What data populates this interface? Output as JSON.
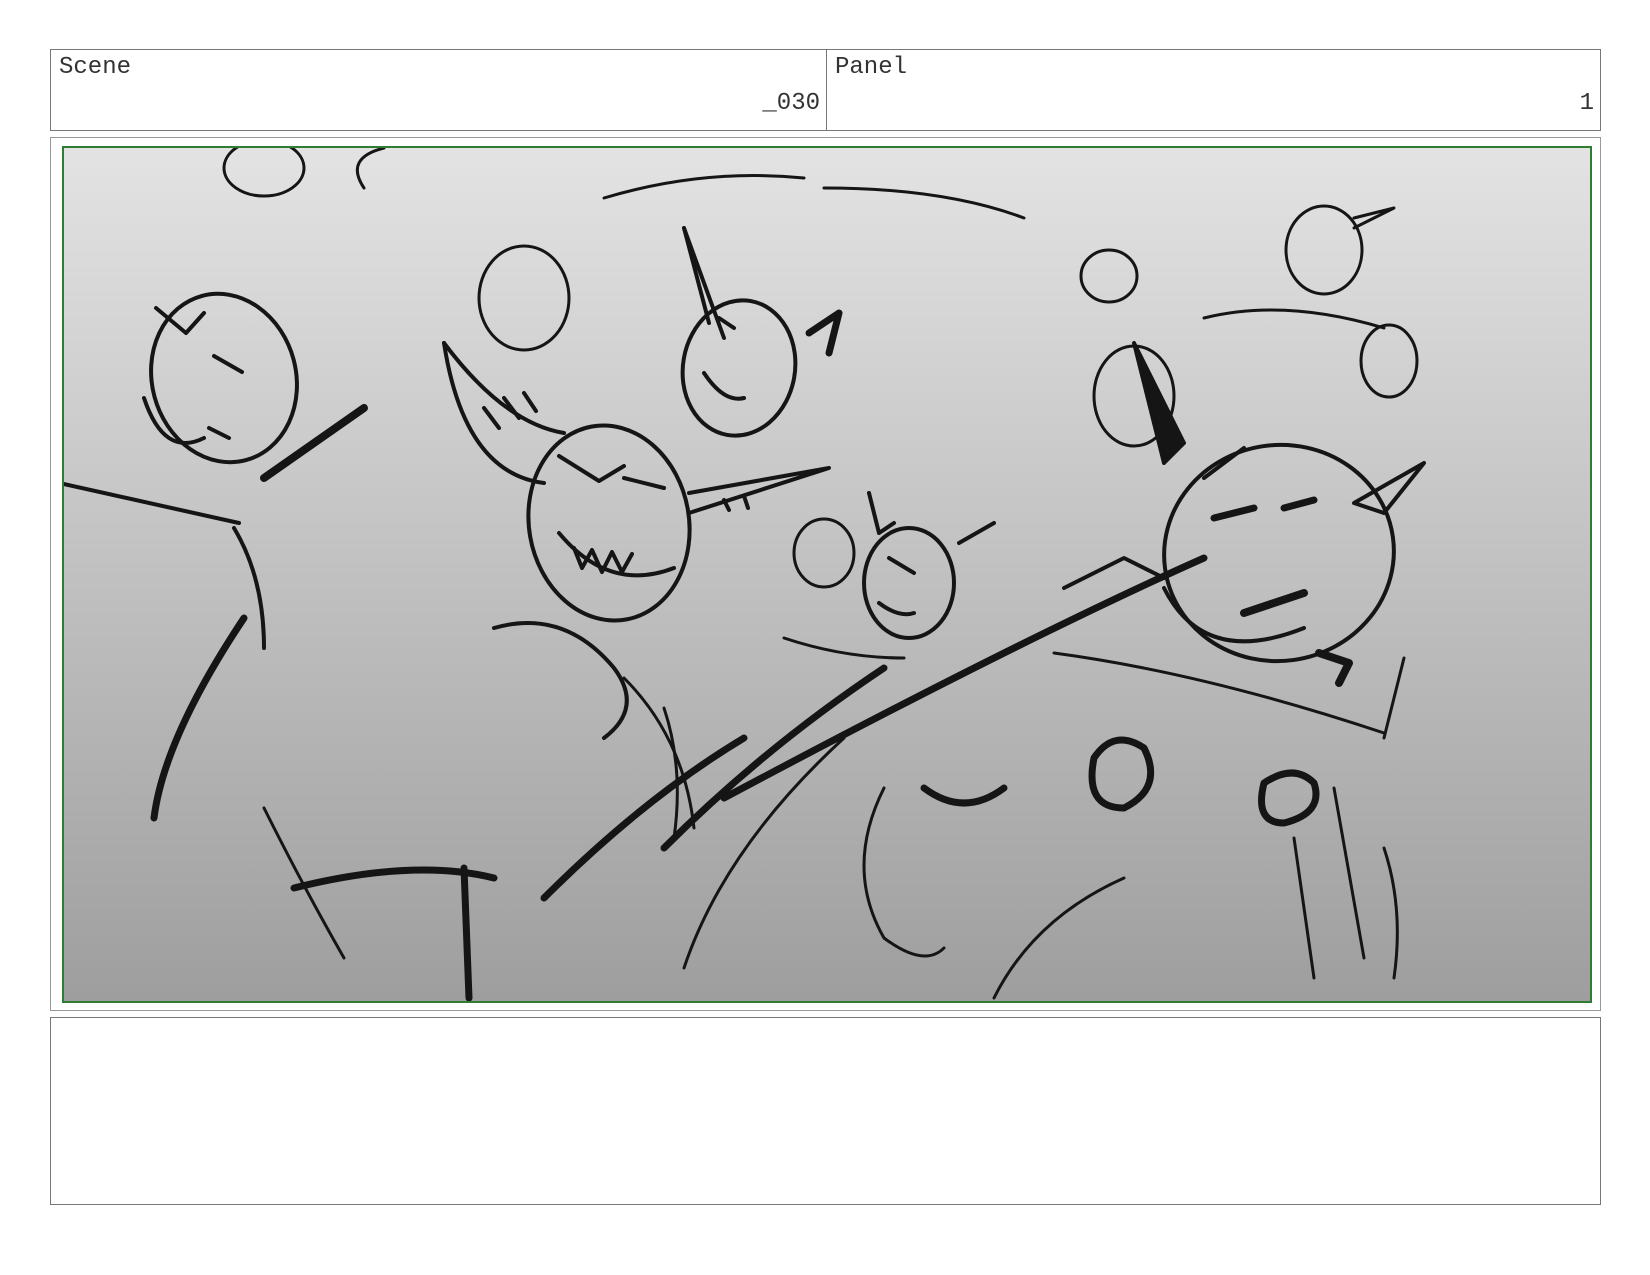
{
  "header": {
    "scene_label": "Scene",
    "scene_value": "_030",
    "panel_label": "Panel",
    "panel_value": "1"
  },
  "colors": {
    "frame_border": "#2e7d32",
    "sketch_stroke": "#151515"
  },
  "notes_text": ""
}
